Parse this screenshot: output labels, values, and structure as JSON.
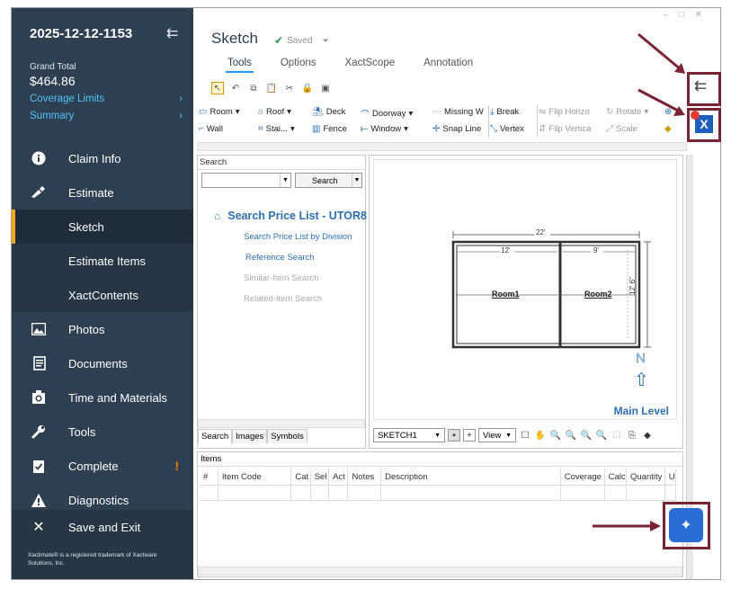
{
  "sidebar": {
    "claim_id": "2025-12-12-1153",
    "grand_total_label": "Grand Total",
    "grand_total_value": "$464.86",
    "links": [
      "Coverage Limits",
      "Summary"
    ],
    "nav": {
      "claim_info": "Claim Info",
      "estimate": "Estimate",
      "sketch": "Sketch",
      "estimate_items": "Estimate Items",
      "xactcontents": "XactContents",
      "photos": "Photos",
      "documents": "Documents",
      "time_materials": "Time and Materials",
      "tools": "Tools",
      "complete": "Complete",
      "diagnostics": "Diagnostics",
      "save_exit": "Save and Exit"
    },
    "complete_alert": "!",
    "trademark": "Xactimate® is a registered trademark of Xactware Solutions, Inc."
  },
  "header": {
    "title": "Sketch",
    "saved": "Saved",
    "tabs": [
      "Tools",
      "Options",
      "XactScope",
      "Annotation"
    ],
    "active_tab": "Tools"
  },
  "ribbon": {
    "room": "Room",
    "roof": "Roof",
    "deck": "Deck",
    "doorway": "Doorway",
    "missing": "Missing W",
    "wall": "Wall",
    "stairs": "Stai...",
    "fence": "Fence",
    "window": "Window",
    "snap": "Snap Line",
    "break": "Break",
    "vertex": "Vertex",
    "flip_h": "Flip Horizo",
    "flip_v": "Flip Vertica",
    "rotate": "Rotate",
    "scale": "Scale"
  },
  "search_panel": {
    "header": "Search",
    "search_button": "Search",
    "title": "Search Price List - UTOR8",
    "links": [
      "Search Price List by Division",
      "Reference Search"
    ],
    "disabled_links": [
      "Similar-Item Search",
      "Related-Item Search"
    ],
    "tabs": [
      "Search",
      "Images",
      "Symbols"
    ]
  },
  "canvas": {
    "overall_width": "22'",
    "room1_width": "12'",
    "room2_width": "9'",
    "height": "12' 6\"",
    "room1_label": "Room1",
    "room2_label": "Room2",
    "north": "N",
    "level": "Main Level",
    "sketch_name": "SKETCH1",
    "view_label": "View"
  },
  "items": {
    "header": "Items",
    "columns": [
      "#",
      "Item Code",
      "Cat",
      "Sel",
      "Act",
      "Notes",
      "Description",
      "Coverage",
      "Calc",
      "Quantity",
      "U"
    ]
  },
  "colors": {
    "sidebar": "#2e3f52",
    "accent": "#4fc3f7",
    "highlight_box": "#7a2433",
    "fab": "#2a6cd6"
  }
}
